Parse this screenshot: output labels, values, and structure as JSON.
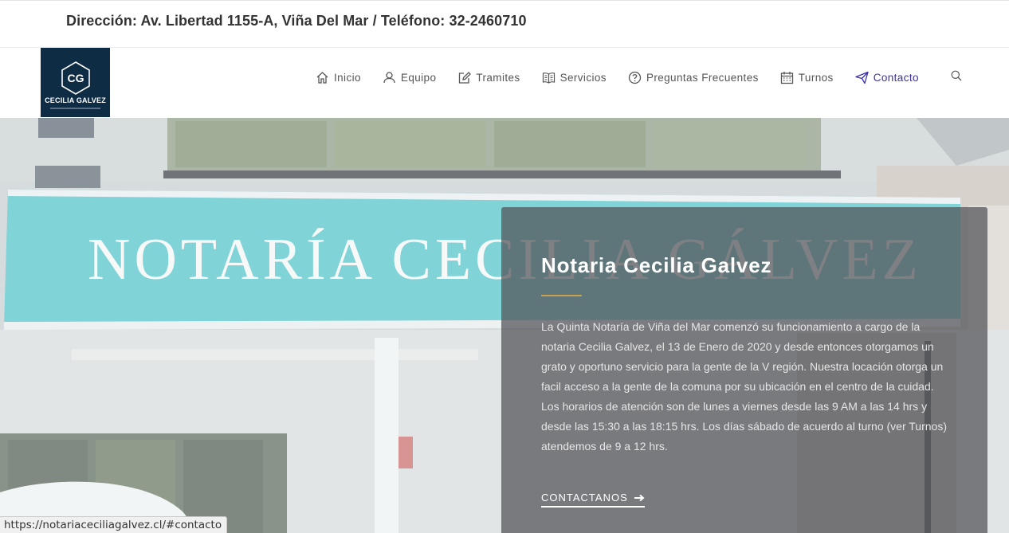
{
  "topbar": {
    "text": "Dirección: Av. Libertad 1155-A, Viña Del Mar / Teléfono: 32-2460710"
  },
  "logo": {
    "initials": "CG",
    "name": "CECILIA GALVEZ"
  },
  "nav": {
    "items": [
      {
        "label": "Inicio",
        "icon": "home-icon"
      },
      {
        "label": "Equipo",
        "icon": "user-icon"
      },
      {
        "label": "Tramites",
        "icon": "edit-icon"
      },
      {
        "label": "Servicios",
        "icon": "book-icon"
      },
      {
        "label": "Preguntas Frecuentes",
        "icon": "question-icon"
      },
      {
        "label": "Turnos",
        "icon": "calendar-icon"
      },
      {
        "label": "Contacto",
        "icon": "paper-plane-icon"
      }
    ],
    "active_color": "#3a2fb0"
  },
  "hero": {
    "sign_text": "NOTARÍA CECILIA GÁLVEZ",
    "title": "Notaria Cecilia Galvez",
    "paragraph": "La Quinta Notaría de Viña del Mar comenzó su funcionamiento a cargo de la notaria Cecilia Galvez, el 13 de Enero de 2020 y desde entonces otorgamos un grato y oportuno servicio para la gente de la V región. Nuestra locación otorga un facil acceso a la gente de la comuna por su ubicación en el centro de la cuidad. Los horarios de atención son de lunes a viernes desde las 9 AM a las 14 hrs y desde las 15:30 a las 18:15 hrs. Los días sábado de acuerdo al turno (ver Turnos) atendemos de 9 a 12 hrs.",
    "cta_label": "CONTACTANOS",
    "accent_color": "#c9a24f"
  },
  "statusbar": {
    "url": "https://notariaceciliagalvez.cl/#contacto"
  }
}
